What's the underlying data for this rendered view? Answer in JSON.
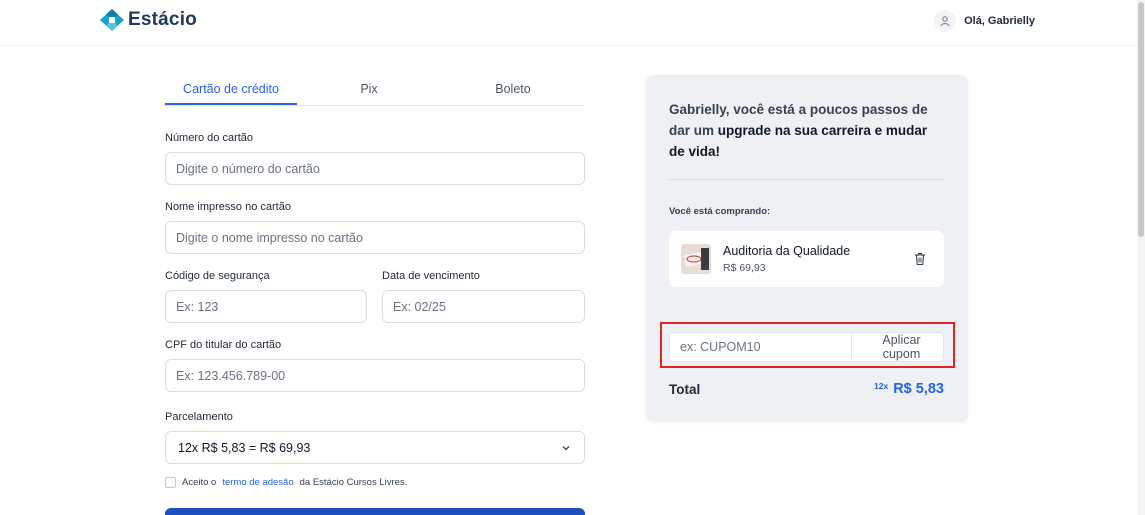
{
  "header": {
    "brand": "Estácio",
    "greeting": "Olá, Gabrielly"
  },
  "payment": {
    "tabs": [
      {
        "label": "Cartão de crédito",
        "active": true
      },
      {
        "label": "Pix",
        "active": false
      },
      {
        "label": "Boleto",
        "active": false
      }
    ],
    "card_number": {
      "label": "Número do cartão",
      "placeholder": "Digite o número do cartão",
      "value": ""
    },
    "card_name": {
      "label": "Nome impresso no cartão",
      "placeholder": "Digite o nome impresso no cartão",
      "value": ""
    },
    "security_code": {
      "label": "Código de segurança",
      "placeholder": "Ex: 123",
      "value": ""
    },
    "expiry": {
      "label": "Data de vencimento",
      "placeholder": "Ex: 02/25",
      "value": ""
    },
    "cpf": {
      "label": "CPF do titular do cartão",
      "placeholder": "Ex: 123.456.789-00",
      "value": ""
    },
    "installments": {
      "label": "Parcelamento",
      "selected": "12x R$ 5,83 = R$ 69,93"
    },
    "terms": {
      "prefix": "Aceito o",
      "link": "termo de adesão",
      "suffix": "da Estácio Cursos Livres.",
      "checked": false
    }
  },
  "summary": {
    "title_part1": "Gabrielly, você está a poucos passos de dar um",
    "title_part2": "upgrade na sua carreira e mudar de vida!",
    "buying_label": "Você está comprando:",
    "product": {
      "name": "Auditoria da Qualidade",
      "price": "R$ 69,93"
    },
    "coupon": {
      "placeholder": "ex: CUPOM10",
      "value": "",
      "button": "Aplicar cupom"
    },
    "total_label": "Total",
    "total_installments": "12x",
    "total_amount": "R$ 5,83"
  },
  "colors": {
    "accent": "#2563eb",
    "brand_dark": "#1e3a5f",
    "highlight_border": "#e02424",
    "summary_bg": "#eef0f4"
  },
  "icons": [
    "estacio-logo-icon",
    "user-icon",
    "chevron-down-icon",
    "trash-icon"
  ]
}
